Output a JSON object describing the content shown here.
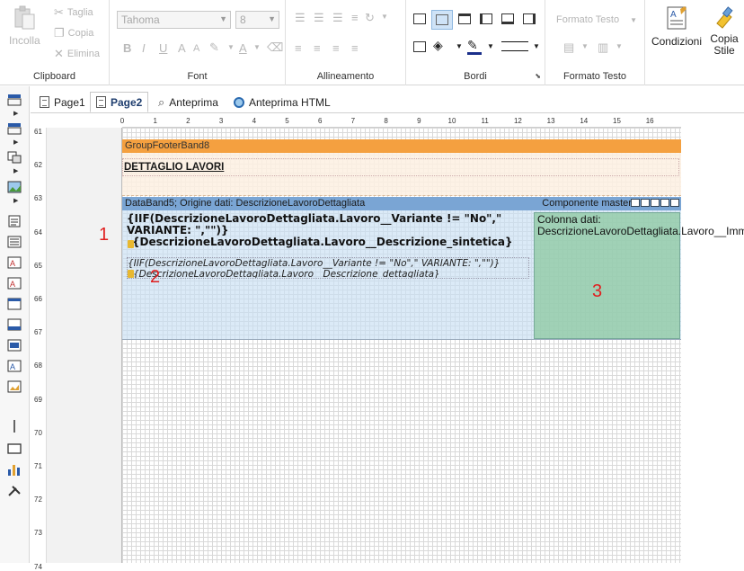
{
  "ribbon": {
    "clipboard": {
      "label": "Clipboard",
      "paste": "Incolla",
      "cut": "Taglia",
      "copy": "Copia",
      "delete": "Elimina"
    },
    "font": {
      "label": "Font",
      "family": "Tahoma",
      "size": "8"
    },
    "alignment": {
      "label": "Allineamento"
    },
    "borders": {
      "label": "Bordi"
    },
    "text_format": {
      "label": "Formato Testo",
      "combo": "Formato Testo"
    },
    "conditions": "Condizioni",
    "copy_style": "Copia\nStile"
  },
  "tabs": [
    {
      "label": "Page1"
    },
    {
      "label": "Page2"
    },
    {
      "label": "Anteprima"
    },
    {
      "label": "Anteprima HTML"
    }
  ],
  "hruler_numbers": [
    "0",
    "1",
    "2",
    "3",
    "4",
    "5",
    "6",
    "7",
    "8",
    "9",
    "10",
    "11",
    "12",
    "13",
    "14",
    "15",
    "16"
  ],
  "vruler_numbers": [
    "61",
    "62",
    "63",
    "64",
    "65",
    "66",
    "67",
    "68",
    "69",
    "70",
    "71",
    "72",
    "73",
    "74"
  ],
  "bands": {
    "group_footer": {
      "title": "GroupFooterBand8",
      "text": "DETTAGLIO LAVORI"
    },
    "data_band": {
      "title": "DataBand5; Origine dati: DescrizioneLavoroDettagliata",
      "master": "Componente master:",
      "text1_line1": "{IIF(DescrizioneLavoroDettagliata.Lavoro__Variante != \"No\",\"    VARIANTE: \",\"\")}",
      "text1_line2": "{DescrizioneLavoroDettagliata.Lavoro__Descrizione_sintetica}",
      "text2_line1": "{IIF(DescrizioneLavoroDettagliata.Lavoro__Variante != \"No\",\"  VARIANTE: \",\"\")}",
      "text2_line2": "{DescrizioneLavoroDettagliata.Lavoro__Descrizione_dettagliata}",
      "image_text": "Colonna dati: DescrizioneLavoroDettagliata.Lavoro__Immagine"
    }
  },
  "annotations": {
    "a1": "1",
    "a2": "2",
    "a3": "3"
  },
  "colors": {
    "group_footer_header": "#f4a040",
    "data_band_header": "#7aa5d4",
    "image_component": "#8cc8a0",
    "annotation": "#e02020"
  }
}
